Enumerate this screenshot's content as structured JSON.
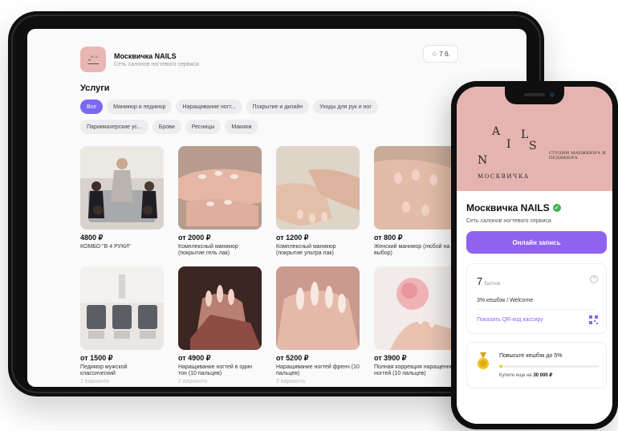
{
  "shop": {
    "name": "Москвичка NAILS",
    "subtitle": "Сеть салонов ногтевого сервиса",
    "rating": "7 б."
  },
  "services": {
    "title": "Услуги",
    "chips_row1": [
      "Все",
      "Маникюр и педикюр",
      "Наращивание ногт...",
      "Покрытие и дизайн",
      "Уходы для рук и ног"
    ],
    "chips_row2": [
      "Парикмахерские ус...",
      "Брови",
      "Ресницы",
      "Макияж"
    ],
    "active_chip": "Все"
  },
  "cards": [
    {
      "price": "4800 ₽",
      "desc": "КОМБО \"В 4 РУКИ\"",
      "variants": ""
    },
    {
      "price": "от 2000 ₽",
      "desc": "Комплексный маникюр (покрытие гель лак)",
      "variants": ""
    },
    {
      "price": "от 1200 ₽",
      "desc": "Комплексный маникюр (покрытие ультра лак)",
      "variants": ""
    },
    {
      "price": "от 800 ₽",
      "desc": "Женский маникюр (любой на выбор)",
      "variants": ""
    },
    {
      "price": "от 1500 ₽",
      "desc": "Педикюр мужской классический",
      "variants": "2 варианта"
    },
    {
      "price": "от 4900 ₽",
      "desc": "Наращивание ногтей в один тон (10 пальцев)",
      "variants": "2 варианта"
    },
    {
      "price": "от 5200 ₽",
      "desc": "Наращивание ногтей френч (10 пальцев)",
      "variants": "2 варианта"
    },
    {
      "price": "от 3900 ₽",
      "desc": "Полная коррекция наращенных ногтей (10 пальцев)",
      "variants": ""
    }
  ],
  "phone": {
    "logo_letters": [
      "A",
      "I",
      "L",
      "N"
    ],
    "logo_s": "S",
    "logo_word": "МОСКВИЧКА",
    "tagline": "СТУДИИ МАНИКЮРА И ПЕДИКЮРА",
    "name": "Москвичка NAILS",
    "subtitle": "Сеть салонов ногтевого сервиса",
    "book_label": "Онлайн запись",
    "points_value": "7",
    "points_unit": "баллов",
    "cashback": "3% кешбэк / Welcome",
    "qr_label": "Показать QR-код кассиру",
    "promo_title": "Повысьте кешбэк до 5%",
    "promo_note_prefix": "Купите еще на",
    "promo_note_amount": "30 000 ₽",
    "promo_progress": 0.03
  },
  "colors": {
    "accent": "#8f62f0",
    "chip_active": "#7b68ee",
    "brand_pink": "#e5b4b0",
    "verified": "#3fb24f",
    "progress": "#f0c419"
  }
}
